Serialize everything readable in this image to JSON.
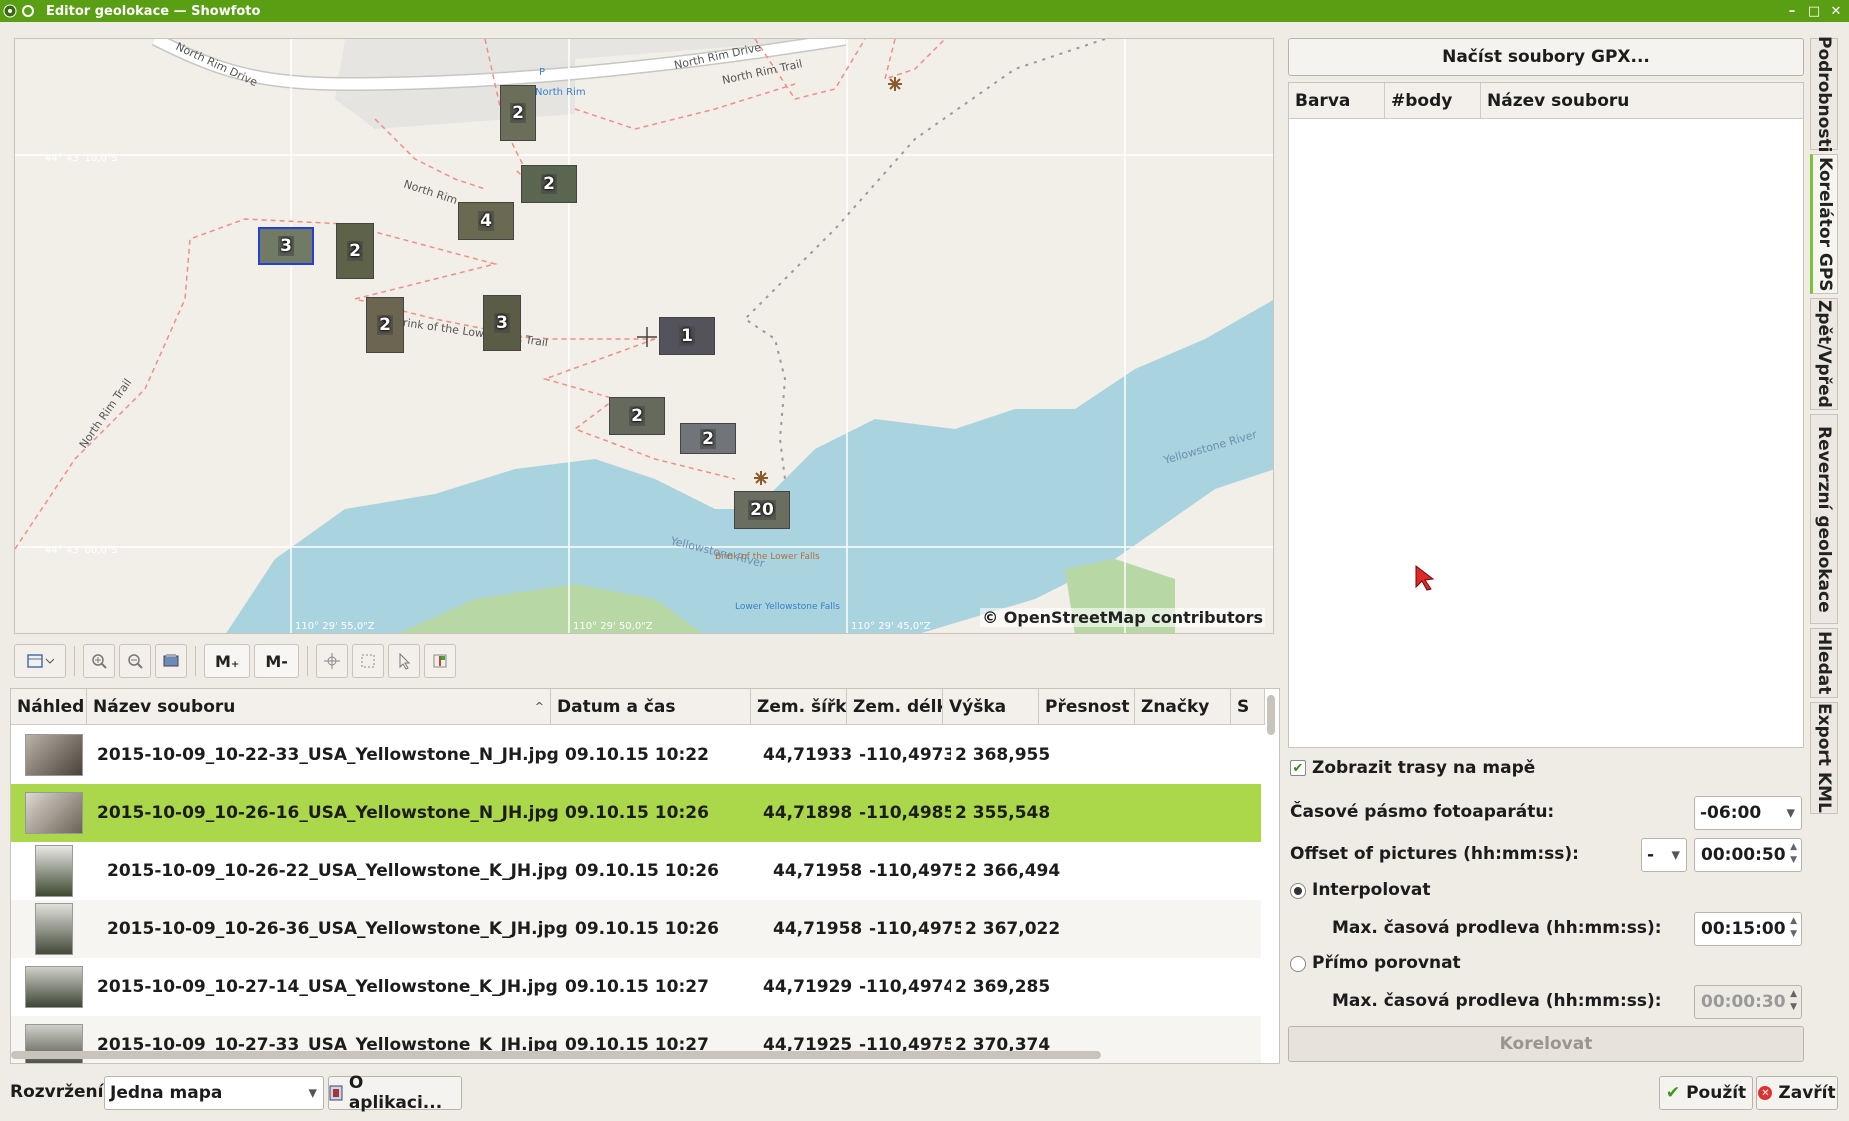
{
  "window": {
    "title": "Editor geolokace — Showfoto",
    "controls": [
      "–",
      "□",
      "✕"
    ]
  },
  "map": {
    "attribution": "© OpenStreetMap contributors",
    "labels": [
      "North Rim Drive",
      "North Rim Drive",
      "North Rim Trail",
      "North Rim",
      "Brink of the Lower Falls Trail",
      "North Rim Trail",
      "Yellowstone River",
      "Yellowstone River",
      "North Rim",
      "P",
      "Brink of the Lower Falls",
      "Lower Yellowstone Falls"
    ],
    "coords": [
      "44° 43' 10,0\"S",
      "44° 43' 00,0\"S",
      "110° 29' 55,0\"Z",
      "110° 29' 50,0\"Z",
      "110° 29' 45,0\"Z"
    ],
    "clusters": [
      {
        "count": "2"
      },
      {
        "count": "2"
      },
      {
        "count": "4"
      },
      {
        "count": "3"
      },
      {
        "count": "2"
      },
      {
        "count": "2"
      },
      {
        "count": "3"
      },
      {
        "count": "1"
      },
      {
        "count": "2"
      },
      {
        "count": "2"
      },
      {
        "count": "20"
      }
    ]
  },
  "toolbar": {
    "m_plus": "M₊",
    "m_minus": "M-"
  },
  "table": {
    "columns": [
      "Náhled",
      "Název souboru",
      "Datum a čas",
      "Zem. šířka",
      "Zem. délka",
      "Výška",
      "Přesnost",
      "Značky",
      "S"
    ],
    "rows": [
      {
        "file": "2015-10-09_10-22-33_USA_Yellowstone_N_JH.jpg",
        "date": "09.10.15 10:22",
        "lat": "44,71933",
        "lon": "-110,4973",
        "alt": "2 368,955"
      },
      {
        "file": "2015-10-09_10-26-16_USA_Yellowstone_N_JH.jpg",
        "date": "09.10.15 10:26",
        "lat": "44,71898",
        "lon": "-110,4985",
        "alt": "2 355,548"
      },
      {
        "file": "2015-10-09_10-26-22_USA_Yellowstone_K_JH.jpg",
        "date": "09.10.15 10:26",
        "lat": "44,71958",
        "lon": "-110,4975",
        "alt": "2 366,494"
      },
      {
        "file": "2015-10-09_10-26-36_USA_Yellowstone_K_JH.jpg",
        "date": "09.10.15 10:26",
        "lat": "44,71958",
        "lon": "-110,4975",
        "alt": "2 367,022"
      },
      {
        "file": "2015-10-09_10-27-14_USA_Yellowstone_K_JH.jpg",
        "date": "09.10.15 10:27",
        "lat": "44,71929",
        "lon": "-110,4974",
        "alt": "2 369,285"
      },
      {
        "file": "2015-10-09_10-27-33_USA_Yellowstone_K_JH.jpg",
        "date": "09.10.15 10:27",
        "lat": "44,71925",
        "lon": "-110,4975",
        "alt": "2 370,374"
      }
    ]
  },
  "bottom": {
    "layout_label": "Rozvržení:",
    "layout_value": "Jedna mapa",
    "about": "O aplikaci...",
    "apply": "Použít",
    "close": "Zavřít"
  },
  "gps": {
    "load_gpx": "Načíst soubory GPX...",
    "gpx_columns": [
      "Barva",
      "#body",
      "Název souboru"
    ],
    "show_tracks": "Zobrazit trasy na mapě",
    "timezone_label": "Časové pásmo fotoaparátu:",
    "timezone_value": "-06:00",
    "offset_label": "Offset of pictures (hh:mm:ss):",
    "offset_sign": "-",
    "offset_value": "00:00:50",
    "interpolate": "Interpolovat",
    "max_gap_label": "Max. časová prodleva (hh:mm:ss):",
    "max_gap_value": "00:15:00",
    "direct": "Přímo porovnat",
    "max_gap_label2": "Max. časová prodleva (hh:mm:ss):",
    "max_gap_value2": "00:00:30",
    "correlate": "Korelovat"
  },
  "tabs": [
    "Podrobnosti",
    "Korelátor GPS",
    "Zpět/Vpřed",
    "Reverzní geolokace",
    "Hledat",
    "Export KML"
  ]
}
